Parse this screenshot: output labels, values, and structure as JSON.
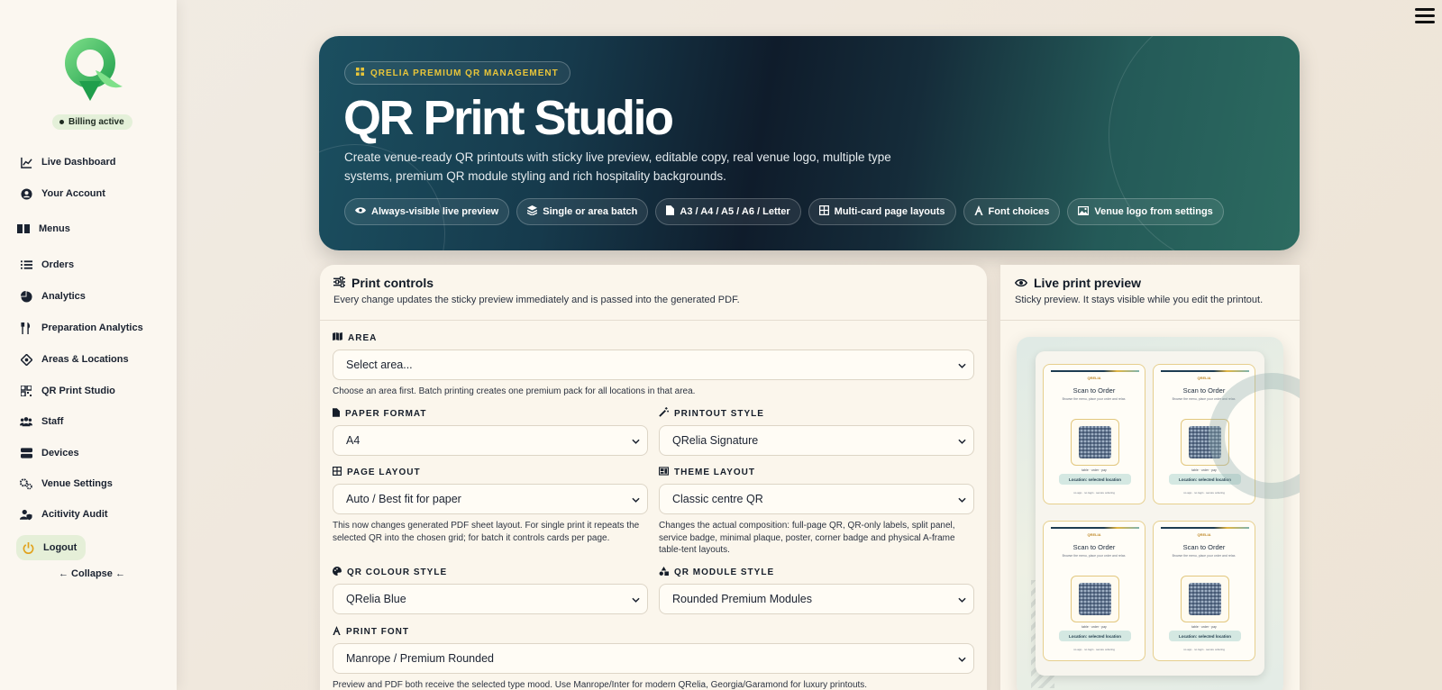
{
  "sidebar": {
    "billing_status": "Billing active",
    "nav": [
      {
        "label": "Live Dashboard",
        "icon": "chart-line-icon"
      },
      {
        "label": "Your Account",
        "icon": "user-circle-icon"
      },
      {
        "label": "Menus",
        "icon": "book-open-icon"
      },
      {
        "label": "Orders",
        "icon": "list-icon"
      },
      {
        "label": "Analytics",
        "icon": "pie-chart-icon"
      },
      {
        "label": "Preparation Analytics",
        "icon": "utensils-icon"
      },
      {
        "label": "Areas & Locations",
        "icon": "location-crosshair-icon"
      },
      {
        "label": "QR Print Studio",
        "icon": "qrcode-icon"
      },
      {
        "label": "Staff",
        "icon": "users-icon"
      },
      {
        "label": "Devices",
        "icon": "server-icon"
      },
      {
        "label": "Venue Settings",
        "icon": "gears-icon"
      },
      {
        "label": "Acitivity Audit",
        "icon": "user-shield-icon"
      },
      {
        "label": "Logout",
        "icon": "power-icon"
      }
    ],
    "collapse_label": "← Collapse ←"
  },
  "hero": {
    "kicker": "QRELIA PREMIUM QR MANAGEMENT",
    "title": "QR Print Studio",
    "description": "Create venue-ready QR printouts with sticky live preview, editable copy, real venue logo, multiple type systems, premium QR module styling and rich hospitality backgrounds.",
    "chips": [
      {
        "label": "Always-visible live preview",
        "icon": "eye-icon"
      },
      {
        "label": "Single or area batch",
        "icon": "layers-icon"
      },
      {
        "label": "A3 / A4 / A5 / A6 / Letter",
        "icon": "file-icon"
      },
      {
        "label": "Multi-card page layouts",
        "icon": "grid-icon"
      },
      {
        "label": "Font choices",
        "icon": "font-icon"
      },
      {
        "label": "Venue logo from settings",
        "icon": "image-icon"
      }
    ]
  },
  "controls": {
    "title": "Print controls",
    "subtitle": "Every change updates the sticky preview immediately and is passed into the generated PDF.",
    "area": {
      "label": "AREA",
      "value": "Select area...",
      "hint": "Choose an area first. Batch printing creates one premium pack for all locations in that area."
    },
    "paper_format": {
      "label": "PAPER FORMAT",
      "value": "A4"
    },
    "printout_style": {
      "label": "PRINTOUT STYLE",
      "value": "QRelia Signature"
    },
    "page_layout": {
      "label": "PAGE LAYOUT",
      "value": "Auto / Best fit for paper",
      "hint": "This now changes generated PDF sheet layout. For single print it repeats the selected QR into the chosen grid; for batch it controls cards per page."
    },
    "theme_layout": {
      "label": "THEME LAYOUT",
      "value": "Classic centre QR",
      "hint": "Changes the actual composition: full-page QR, QR-only labels, split panel, service badge, minimal plaque, poster, corner badge and physical A-frame table-tent layouts."
    },
    "qr_colour_style": {
      "label": "QR COLOUR STYLE",
      "value": "QRelia Blue"
    },
    "qr_module_style": {
      "label": "QR MODULE STYLE",
      "value": "Rounded Premium Modules"
    },
    "print_font": {
      "label": "PRINT FONT",
      "value": "Manrope / Premium Rounded",
      "hint": "Preview and PDF both receive the selected type mood. Use Manrope/Inter for modern QRelia, Georgia/Garamond for luxury printouts."
    }
  },
  "preview": {
    "title": "Live print preview",
    "subtitle": "Sticky preview. It stays visible while you edit the printout.",
    "card": {
      "brand": "QRELIA",
      "heading": "Scan to Order",
      "sub": "Browse the menu, place your order and relax.",
      "qr_caption": "table · order · pay",
      "location": "Location: selected location",
      "footer": "no app · no login · secure ordering"
    }
  },
  "colors": {
    "accent_gold": "#e8c53a",
    "hero_dark": "#0f1c2b",
    "hero_teal": "#2c6b60",
    "logo_green": "#4cc46a"
  }
}
